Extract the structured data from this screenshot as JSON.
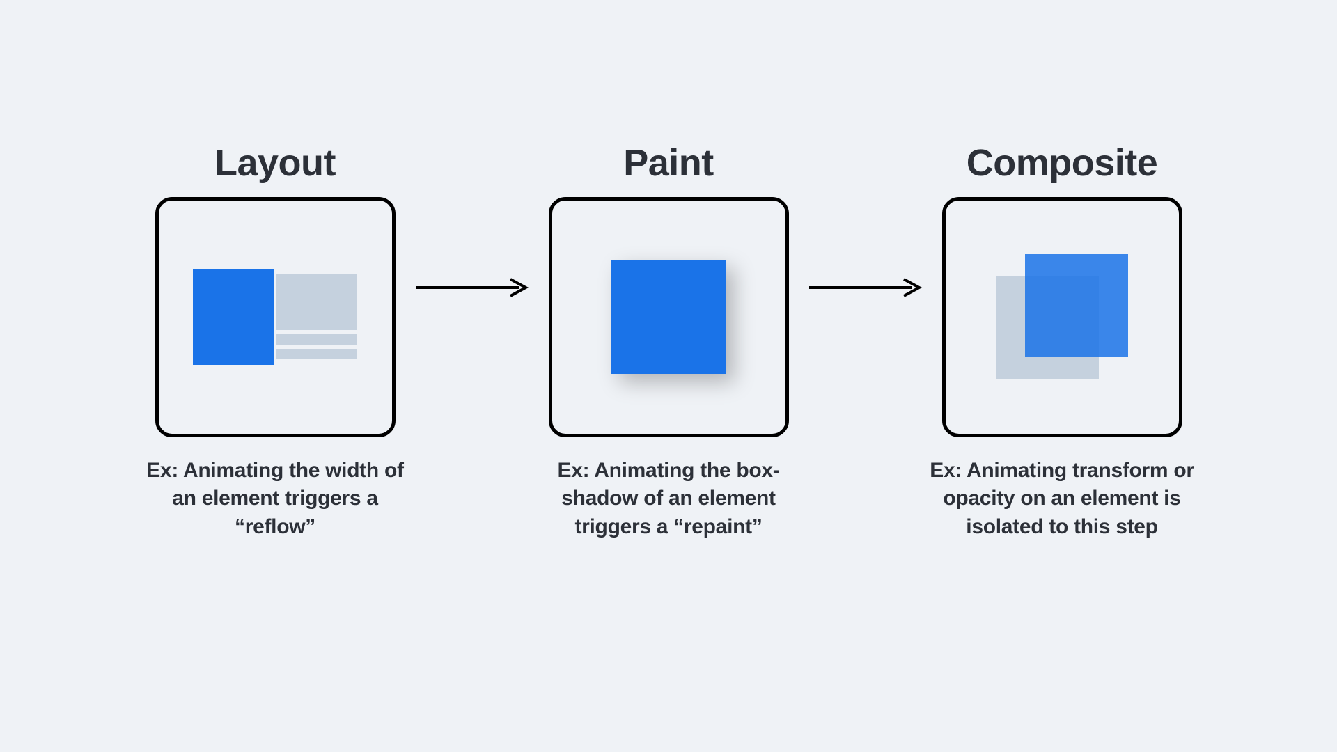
{
  "steps": [
    {
      "title": "Layout",
      "caption": "Ex: Animating the width of an element triggers a “reflow”"
    },
    {
      "title": "Paint",
      "caption": "Ex: Animating the box-shadow of an element triggers a “repaint”"
    },
    {
      "title": "Composite",
      "caption": "Ex: Animating transform or opacity on an element is isolated to this step"
    }
  ],
  "colors": {
    "accent": "#1a73e8",
    "muted": "#c5d1de",
    "text": "#2c3038",
    "background": "#eff2f6"
  }
}
